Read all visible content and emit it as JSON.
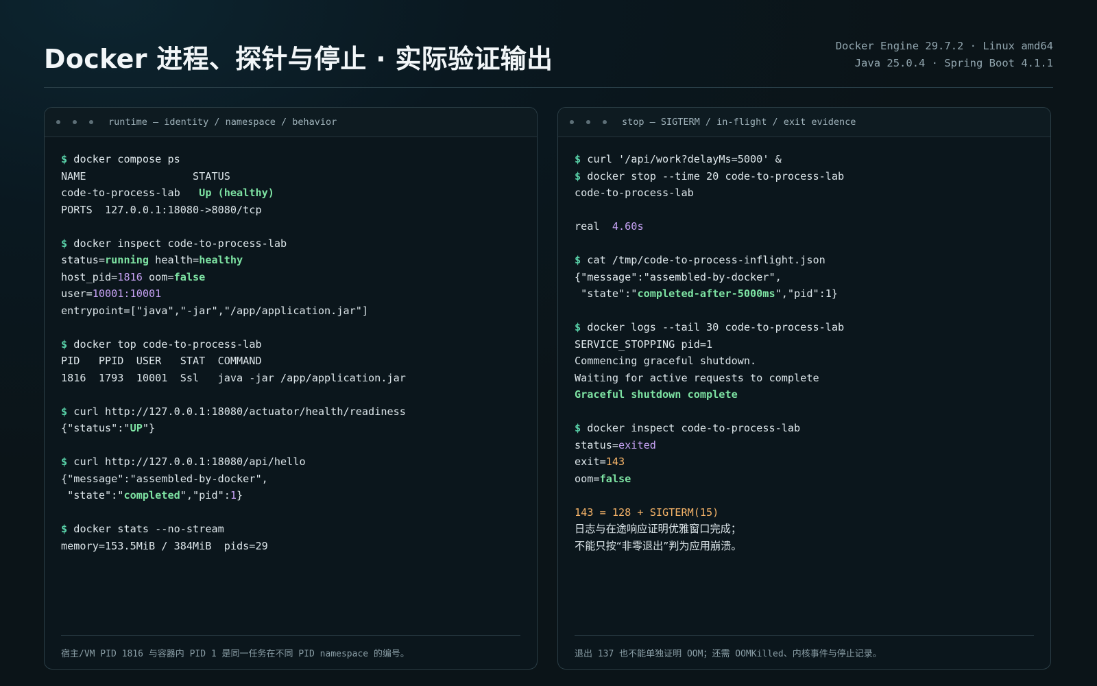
{
  "header": {
    "title": "Docker 进程、探针与停止 · 实际验证输出",
    "meta_line1": "Docker Engine 29.7.2 · Linux amd64",
    "meta_line2": "Java 25.0.4 · Spring Boot 4.1.1"
  },
  "colors": {
    "prompt": "#59d2a9",
    "ok": "#7ee3a3",
    "value": "#c7a3f5",
    "warn": "#f5b368"
  },
  "left_panel": {
    "title": "runtime — identity / namespace / behavior",
    "footer": "宿主/VM PID 1816 与容器内 PID 1 是同一任务在不同 PID namespace 的编号。",
    "lines": [
      [
        {
          "t": "$ ",
          "c": "p"
        },
        {
          "t": "docker compose ps"
        }
      ],
      [
        {
          "t": "NAME                 STATUS"
        }
      ],
      [
        {
          "t": "code-to-process-lab   "
        },
        {
          "t": "Up (healthy)",
          "c": "g"
        }
      ],
      [
        {
          "t": "PORTS  127.0.0.1:18080->8080/tcp"
        }
      ],
      [],
      [
        {
          "t": "$ ",
          "c": "p"
        },
        {
          "t": "docker inspect code-to-process-lab"
        }
      ],
      [
        {
          "t": "status="
        },
        {
          "t": "running",
          "c": "g"
        },
        {
          "t": " health="
        },
        {
          "t": "healthy",
          "c": "g"
        }
      ],
      [
        {
          "t": "host_pid="
        },
        {
          "t": "1816",
          "c": "v"
        },
        {
          "t": " oom="
        },
        {
          "t": "false",
          "c": "g"
        }
      ],
      [
        {
          "t": "user="
        },
        {
          "t": "10001:10001",
          "c": "v"
        }
      ],
      [
        {
          "t": "entrypoint=[\"java\",\"-jar\",\"/app/application.jar\"]"
        }
      ],
      [],
      [
        {
          "t": "$ ",
          "c": "p"
        },
        {
          "t": "docker top code-to-process-lab"
        }
      ],
      [
        {
          "t": "PID   PPID  USER   STAT  COMMAND"
        }
      ],
      [
        {
          "t": "1816  1793  10001  Ssl   java -jar /app/application.jar"
        }
      ],
      [],
      [
        {
          "t": "$ ",
          "c": "p"
        },
        {
          "t": "curl http://127.0.0.1:18080/actuator/health/readiness"
        }
      ],
      [
        {
          "t": "{\"status\":\""
        },
        {
          "t": "UP",
          "c": "g"
        },
        {
          "t": "\"}"
        }
      ],
      [],
      [
        {
          "t": "$ ",
          "c": "p"
        },
        {
          "t": "curl http://127.0.0.1:18080/api/hello"
        }
      ],
      [
        {
          "t": "{\"message\":\"assembled-by-docker\","
        }
      ],
      [
        {
          "t": " \"state\":\""
        },
        {
          "t": "completed",
          "c": "g"
        },
        {
          "t": "\",\"pid\":"
        },
        {
          "t": "1",
          "c": "v"
        },
        {
          "t": "}"
        }
      ],
      [],
      [
        {
          "t": "$ ",
          "c": "p"
        },
        {
          "t": "docker stats --no-stream"
        }
      ],
      [
        {
          "t": "memory=153.5MiB / 384MiB  pids=29"
        }
      ]
    ]
  },
  "right_panel": {
    "title": "stop — SIGTERM / in-flight / exit evidence",
    "footer": "退出 137 也不能单独证明 OOM；还需 OOMKilled、内核事件与停止记录。",
    "lines": [
      [
        {
          "t": "$ ",
          "c": "p"
        },
        {
          "t": "curl '/api/work?delayMs=5000' &"
        }
      ],
      [
        {
          "t": "$ ",
          "c": "p"
        },
        {
          "t": "docker stop --time 20 code-to-process-lab"
        }
      ],
      [
        {
          "t": "code-to-process-lab"
        }
      ],
      [],
      [
        {
          "t": "real  "
        },
        {
          "t": "4.60s",
          "c": "v"
        }
      ],
      [],
      [
        {
          "t": "$ ",
          "c": "p"
        },
        {
          "t": "cat /tmp/code-to-process-inflight.json"
        }
      ],
      [
        {
          "t": "{\"message\":\"assembled-by-docker\","
        }
      ],
      [
        {
          "t": " \"state\":\""
        },
        {
          "t": "completed-after-5000ms",
          "c": "g"
        },
        {
          "t": "\",\"pid\":1}"
        }
      ],
      [],
      [
        {
          "t": "$ ",
          "c": "p"
        },
        {
          "t": "docker logs --tail 30 code-to-process-lab"
        }
      ],
      [
        {
          "t": "SERVICE_STOPPING pid=1"
        }
      ],
      [
        {
          "t": "Commencing graceful shutdown."
        }
      ],
      [
        {
          "t": "Waiting for active requests to complete"
        }
      ],
      [
        {
          "t": "Graceful shutdown complete",
          "c": "g"
        }
      ],
      [],
      [
        {
          "t": "$ ",
          "c": "p"
        },
        {
          "t": "docker inspect code-to-process-lab"
        }
      ],
      [
        {
          "t": "status="
        },
        {
          "t": "exited",
          "c": "v"
        }
      ],
      [
        {
          "t": "exit="
        },
        {
          "t": "143",
          "c": "o"
        }
      ],
      [
        {
          "t": "oom="
        },
        {
          "t": "false",
          "c": "g"
        }
      ],
      [],
      [
        {
          "t": "143 = 128 + SIGTERM(15)",
          "c": "o"
        }
      ],
      [
        {
          "t": "日志与在途响应证明优雅窗口完成；",
          "c": "cjk"
        }
      ],
      [
        {
          "t": "不能只按“非零退出”判为应用崩溃。",
          "c": "cjk"
        }
      ]
    ]
  }
}
